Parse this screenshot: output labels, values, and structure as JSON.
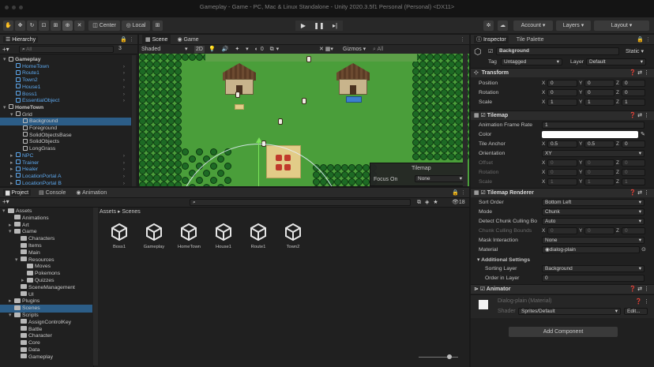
{
  "window": {
    "title": "Gameplay - Game - PC, Mac & Linux Standalone - Unity 2020.3.5f1 Personal (Personal) <DX11>"
  },
  "toolbar": {
    "pivot_label": "Center",
    "space_label": "Local",
    "account_label": "Account",
    "layers_label": "Layers",
    "layout_label": "Layout"
  },
  "hierarchy": {
    "tab": "Hierarchy",
    "search_placeholder": "All",
    "count": "3",
    "items": [
      {
        "label": "Gameplay",
        "depth": 0
      },
      {
        "label": "HomeTown",
        "depth": 1
      },
      {
        "label": "Route1",
        "depth": 1
      },
      {
        "label": "Town2",
        "depth": 1
      },
      {
        "label": "House1",
        "depth": 1
      },
      {
        "label": "Boss1",
        "depth": 1
      },
      {
        "label": "EssentialObject",
        "depth": 1
      },
      {
        "label": "HomeTown",
        "depth": 0
      },
      {
        "label": "Grid",
        "depth": 1
      },
      {
        "label": "Background",
        "depth": 2
      },
      {
        "label": "Foreground",
        "depth": 2
      },
      {
        "label": "SolidObjectsBase",
        "depth": 2
      },
      {
        "label": "SolidObjects",
        "depth": 2
      },
      {
        "label": "LongGrass",
        "depth": 2
      },
      {
        "label": "NPC",
        "depth": 1
      },
      {
        "label": "Trainer",
        "depth": 1
      },
      {
        "label": "Healer",
        "depth": 1
      },
      {
        "label": "LocationPortal A",
        "depth": 1
      },
      {
        "label": "LocationPortal B",
        "depth": 1
      }
    ]
  },
  "scene": {
    "tabs": [
      "Scene",
      "Game"
    ],
    "shading": "Shaded",
    "mode_2d": "2D",
    "gizmos": "Gizmos",
    "search_placeholder": "All",
    "overlay": {
      "title": "Tilemap",
      "focus_label": "Focus On",
      "focus_value": "None"
    }
  },
  "project": {
    "tabs": [
      "Project",
      "Console",
      "Animation"
    ],
    "breadcrumb": [
      "Assets",
      "Scenes"
    ],
    "count": "18",
    "tree": [
      {
        "label": "Assets",
        "depth": 0
      },
      {
        "label": "Animations",
        "depth": 1
      },
      {
        "label": "Art",
        "depth": 1
      },
      {
        "label": "Game",
        "depth": 1
      },
      {
        "label": "Characters",
        "depth": 2
      },
      {
        "label": "Items",
        "depth": 2
      },
      {
        "label": "Main",
        "depth": 2
      },
      {
        "label": "Resources",
        "depth": 2
      },
      {
        "label": "Moves",
        "depth": 3
      },
      {
        "label": "Pokemons",
        "depth": 3
      },
      {
        "label": "Quizzes",
        "depth": 3
      },
      {
        "label": "SceneManagement",
        "depth": 2
      },
      {
        "label": "UI",
        "depth": 2
      },
      {
        "label": "Plugins",
        "depth": 1
      },
      {
        "label": "Scenes",
        "depth": 1
      },
      {
        "label": "Scripts",
        "depth": 1
      },
      {
        "label": "AssignControlKey",
        "depth": 2
      },
      {
        "label": "Battle",
        "depth": 2
      },
      {
        "label": "Character",
        "depth": 2
      },
      {
        "label": "Core",
        "depth": 2
      },
      {
        "label": "Data",
        "depth": 2
      },
      {
        "label": "Gameplay",
        "depth": 2
      }
    ],
    "scenes": [
      "Boss1",
      "Gameplay",
      "HomeTown",
      "House1",
      "Route1",
      "Town2"
    ]
  },
  "inspector": {
    "tabs": [
      "Inspector",
      "Tile Palette"
    ],
    "object_name": "Background",
    "static_label": "Static",
    "tag_label": "Tag",
    "tag_value": "Untagged",
    "layer_label": "Layer",
    "layer_value": "Default",
    "transform": {
      "title": "Transform",
      "rows": [
        {
          "label": "Position",
          "x": "0",
          "y": "0",
          "z": "0"
        },
        {
          "label": "Rotation",
          "x": "0",
          "y": "0",
          "z": "0"
        },
        {
          "label": "Scale",
          "x": "1",
          "y": "1",
          "z": "1"
        }
      ]
    },
    "tilemap": {
      "title": "Tilemap",
      "frame_rate_label": "Animation Frame Rate",
      "frame_rate": "1",
      "color_label": "Color",
      "anchor_label": "Tile Anchor",
      "anchor_x": "0.5",
      "anchor_y": "0.5",
      "anchor_z": "0",
      "orientation_label": "Orientation",
      "orientation": "XY",
      "offset_label": "Offset",
      "offset_x": "0",
      "offset_y": "0",
      "offset_z": "0",
      "rotation_label": "Rotation",
      "rotation_x": "0",
      "rotation_y": "0",
      "rotation_z": "0",
      "scale_label": "Scale",
      "scale_x": "1",
      "scale_y": "1",
      "scale_z": "1"
    },
    "renderer": {
      "title": "Tilemap Renderer",
      "sort_order_label": "Sort Order",
      "sort_order": "Bottom Left",
      "mode_label": "Mode",
      "mode": "Chunk",
      "detect_label": "Detect Chunk Culling Bo",
      "detect": "Auto",
      "bounds_label": "Chunk Culling Bounds",
      "bounds_x": "0",
      "bounds_y": "0",
      "bounds_z": "0",
      "mask_label": "Mask Interaction",
      "mask": "None",
      "material_label": "Material",
      "material": "dialog-plain",
      "additional_label": "Additional Settings",
      "sorting_layer_label": "Sorting Layer",
      "sorting_layer": "Background",
      "order_label": "Order in Layer",
      "order": "0"
    },
    "animator": {
      "title": "Animator"
    },
    "material": {
      "name": "Dialog-plain (Material)",
      "shader_label": "Shader",
      "shader": "Sprites/Default",
      "edit_label": "Edit..."
    },
    "add_component": "Add Component"
  },
  "colors": {
    "selection": "#2c5d87",
    "accent_blue": "#5da8ee",
    "grass": "#4a9e3a"
  }
}
